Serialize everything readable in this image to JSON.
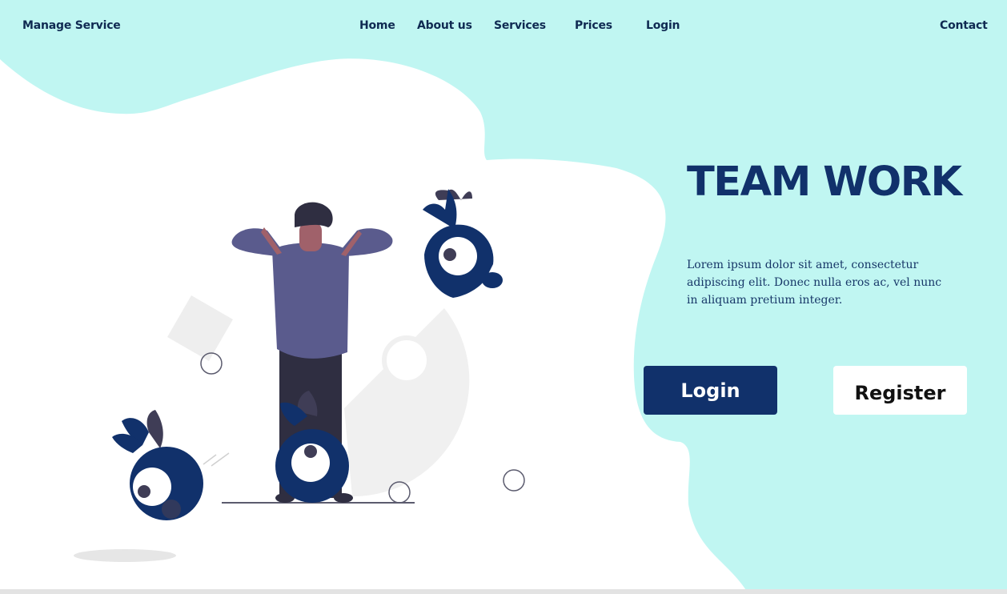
{
  "nav": {
    "brand": "Manage Service",
    "items": [
      {
        "label": "Home"
      },
      {
        "label": "About us"
      },
      {
        "label": "Services"
      },
      {
        "label": "Prices"
      },
      {
        "label": "Login"
      }
    ],
    "contact": "Contact"
  },
  "hero": {
    "title": "TEAM WORK",
    "description": "Lorem ipsum dolor sit amet, consectetur adipiscing elit. Donec nulla eros ac, vel nunc in aliquam pretium integer.",
    "login_label": "Login",
    "register_label": "Register"
  },
  "colors": {
    "background": "#c0f6f2",
    "primary": "#11316b",
    "accent_purple": "#5a5b8d"
  }
}
